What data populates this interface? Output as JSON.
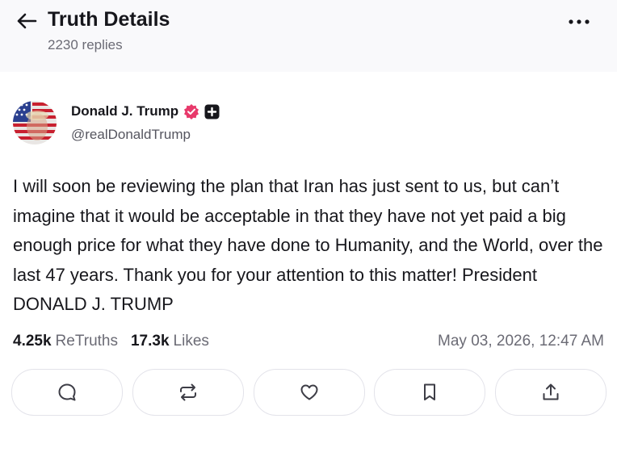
{
  "header": {
    "title": "Truth Details",
    "replies": "2230 replies"
  },
  "author": {
    "name": "Donald J. Trump",
    "handle": "@realDonaldTrump",
    "verified_color": "#e8396b"
  },
  "post": {
    "text": "I will soon be reviewing the plan that Iran has just sent to us, but can’t imagine that it would be acceptable in that they have not yet paid a big enough price for what they have done to Humanity, and the World, over the last 47 years. Thank you for your attention to this matter! President DONALD J. TRUMP",
    "retruths_count": "4.25k",
    "retruths_label": "ReTruths",
    "likes_count": "17.3k",
    "likes_label": "Likes",
    "timestamp": "May 03, 2026, 12:47 AM"
  },
  "actions": [
    "reply-icon",
    "retruth-icon",
    "like-icon",
    "bookmark-icon",
    "share-icon"
  ]
}
